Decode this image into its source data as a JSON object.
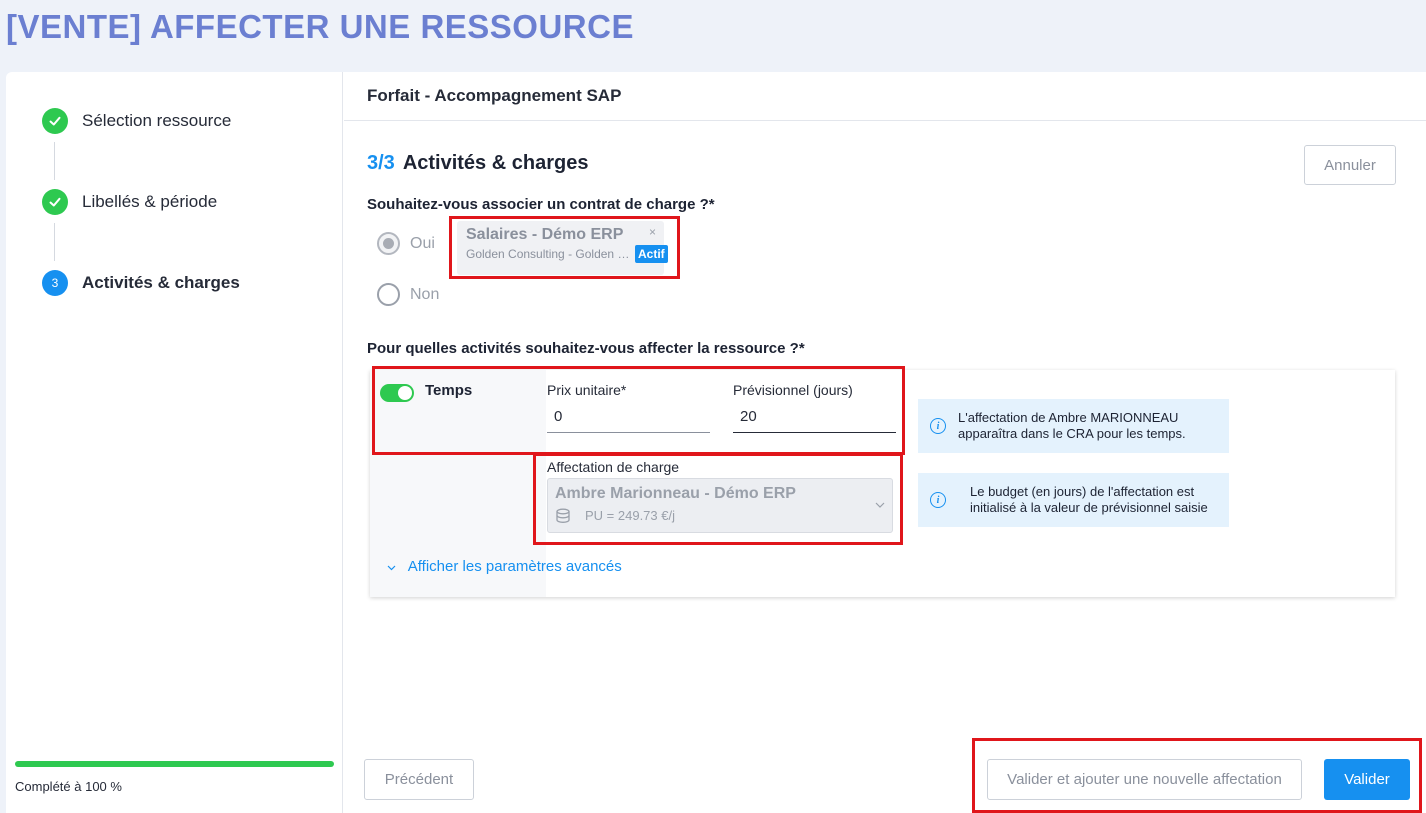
{
  "page": {
    "title": "[VENTE] AFFECTER UNE RESSOURCE"
  },
  "sidebar": {
    "steps": [
      {
        "label": "Sélection ressource",
        "state": "done"
      },
      {
        "label": "Libellés & période",
        "state": "done"
      },
      {
        "label": "Activités & charges",
        "state": "current",
        "number": "3"
      }
    ],
    "progress_text": "Complété à 100 %",
    "progress_value": 100
  },
  "main": {
    "header_title": "Forfait - Accompagnement SAP",
    "section_number": "3/3",
    "section_title": "Activités & charges",
    "cancel_label": "Annuler",
    "question_contract": "Souhaitez-vous associer un contrat de charge ?*",
    "radio_yes": "Oui",
    "radio_no": "Non",
    "contract": {
      "name": "Salaires - Démo ERP",
      "company": "Golden Consulting - Golden Consulting",
      "badge": "Actif",
      "close": "×"
    },
    "question_activities": "Pour quelles activités souhaitez-vous affecter la ressource ?*",
    "activity": {
      "name": "Temps",
      "enabled": true,
      "unit_price_label": "Prix unitaire*",
      "unit_price_value": "0",
      "forecast_label": "Prévisionnel (jours)",
      "forecast_value": "20",
      "charge_label": "Affectation de charge",
      "charge_name": "Ambre Marionneau - Démo ERP",
      "charge_pu": "PU =  249.73 €/j",
      "advanced_link": "Afficher les paramètres avancés"
    },
    "info1": {
      "line1": "L'affectation de Ambre MARIONNEAU",
      "line2": "apparaîtra dans le CRA pour les temps."
    },
    "info2": {
      "line1": "Le budget (en jours) de l'affectation est",
      "line2": "initialisé à la valeur de prévisionnel saisie"
    },
    "buttons": {
      "previous": "Précédent",
      "validate_add": "Valider et ajouter une nouvelle affectation",
      "validate": "Valider"
    }
  },
  "colors": {
    "accent": "#1690f0",
    "success": "#2ec950",
    "title": "#6b7fd1",
    "highlight": "#e0161b"
  }
}
